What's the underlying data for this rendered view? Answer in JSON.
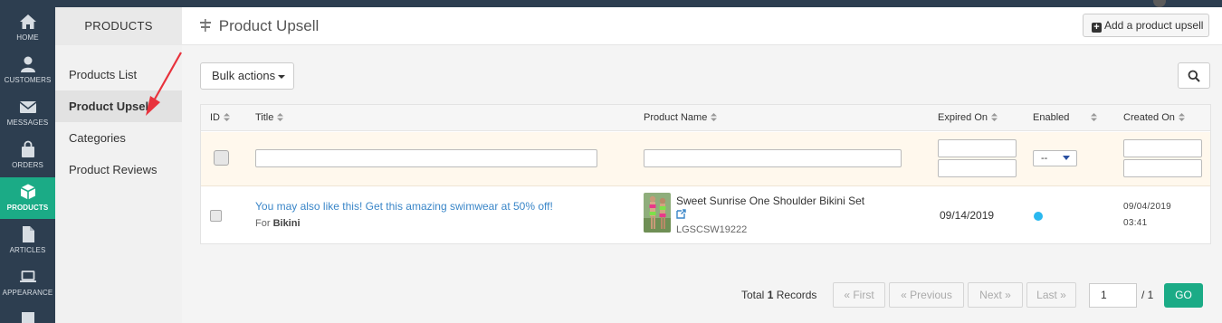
{
  "nav": {
    "items": [
      {
        "label": "HOME",
        "icon": "home-icon"
      },
      {
        "label": "CUSTOMERS",
        "icon": "user-icon"
      },
      {
        "label": "MESSAGES",
        "icon": "envelope-icon"
      },
      {
        "label": "ORDERS",
        "icon": "shopping-bag-icon"
      },
      {
        "label": "PRODUCTS",
        "icon": "cube-icon",
        "active": true
      },
      {
        "label": "ARTICLES",
        "icon": "file-icon"
      },
      {
        "label": "APPEARANCE",
        "icon": "laptop-icon"
      }
    ]
  },
  "subnav": {
    "header": "PRODUCTS",
    "items": [
      {
        "label": "Products List"
      },
      {
        "label": "Product Upsell",
        "active": true
      },
      {
        "label": "Categories"
      },
      {
        "label": "Product Reviews"
      }
    ]
  },
  "header": {
    "title": "Product Upsell",
    "add_button": "Add a product upsell"
  },
  "toolbar": {
    "bulk_actions": "Bulk actions"
  },
  "table": {
    "columns": [
      "ID",
      "Title",
      "Product Name",
      "Expired On",
      "Enabled",
      "Created On"
    ],
    "filters": {
      "enabled_select": "--"
    },
    "rows": [
      {
        "title": "You may also like this! Get this amazing swimwear at 50% off!",
        "for_prefix": "For",
        "for_value": "Bikini",
        "product_name": "Sweet Sunrise One Shoulder Bikini Set",
        "sku": "LGSCSW19222",
        "expired_on": "09/14/2019",
        "enabled": true,
        "created_date": "09/04/2019",
        "created_time": "03:41"
      }
    ]
  },
  "pagination": {
    "total_prefix": "Total",
    "total_count": "1",
    "total_suffix": "Records",
    "first": "« First",
    "previous": "« Previous",
    "next": "Next »",
    "last": "Last »",
    "page": "1",
    "of": "/ 1",
    "go": "GO"
  },
  "colors": {
    "nav_bg": "#2d3e50",
    "accent": "#1bab86",
    "link": "#3a86c8",
    "enabled_dot": "#2ab8ef",
    "annotation": "#e8323c"
  }
}
